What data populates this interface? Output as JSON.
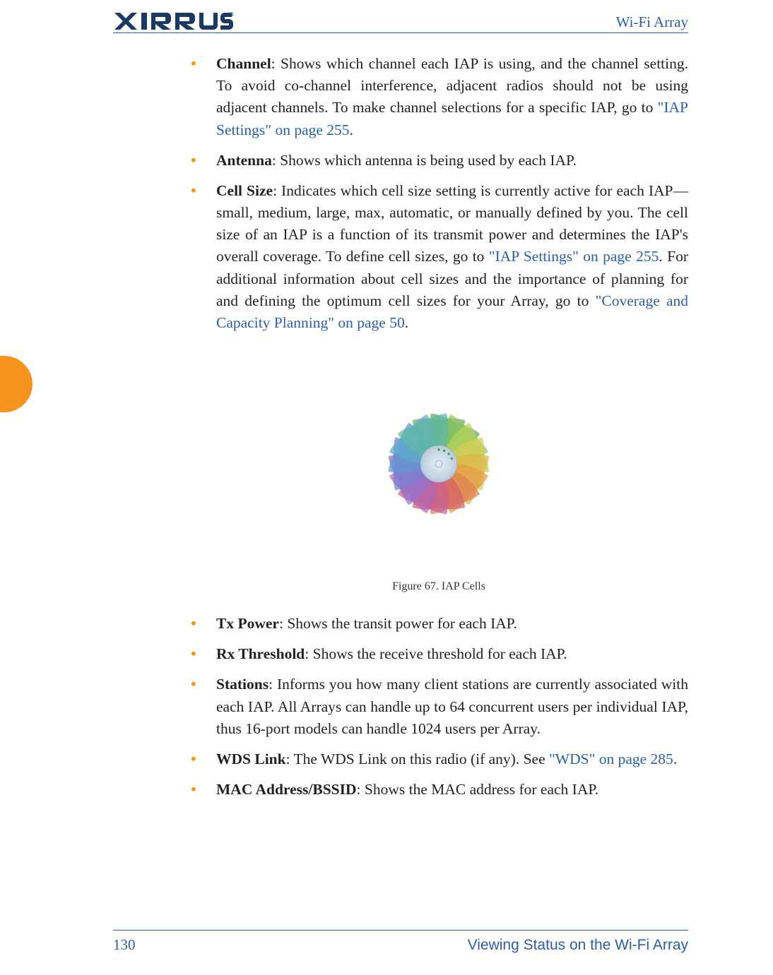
{
  "header": {
    "logo_text": "XIRRUS",
    "right": "Wi-Fi Array"
  },
  "bullets": {
    "b1_term": "Channel",
    "b1_text_a": ": Shows which channel each IAP is using, and the channel setting. To avoid co-channel interference, adjacent radios should not be using adjacent channels. To make channel selections for a specific IAP, go to ",
    "b1_link": "\"IAP Settings\" on page 255",
    "b1_text_b": ".",
    "b2_term": "Antenna",
    "b2_text": ": Shows which antenna is being used by each IAP.",
    "b3_term": "Cell Size",
    "b3_text_a": ": Indicates which cell size setting is currently active for each IAP—small, medium, large, max, automatic, or manually defined by you. The cell size of an IAP is a function of its transmit power and determines the IAP's overall coverage. To define cell sizes, go to ",
    "b3_link1": "\"IAP Settings\" on page 255",
    "b3_text_b": ". For additional information about cell sizes and the importance of planning for and defining the optimum cell sizes for your Array, go to ",
    "b3_link2": "\"Coverage and Capacity Planning\" on page 50",
    "b3_text_c": ".",
    "b4_term": "Tx Power",
    "b4_text": ": Shows the transit power for each IAP.",
    "b5_term": "Rx Threshold",
    "b5_text": ": Shows the receive threshold for each IAP.",
    "b6_term": "Stations",
    "b6_text": ": Informs you how many client stations are currently associated with each IAP. All Arrays can handle up to 64 concurrent users per individual IAP, thus 16-port models can handle 1024 users per Array.",
    "b7_term": "WDS Link",
    "b7_text_a": ": The WDS Link on this radio (if any). See ",
    "b7_link": "\"WDS\" on page 285",
    "b7_text_b": ".",
    "b8_term": "MAC Address/BSSID",
    "b8_text": ": Shows the MAC address for each IAP."
  },
  "figure": {
    "caption": "Figure 67. IAP Cells"
  },
  "footer": {
    "page": "130",
    "section": "Viewing Status on the Wi-Fi Array"
  }
}
